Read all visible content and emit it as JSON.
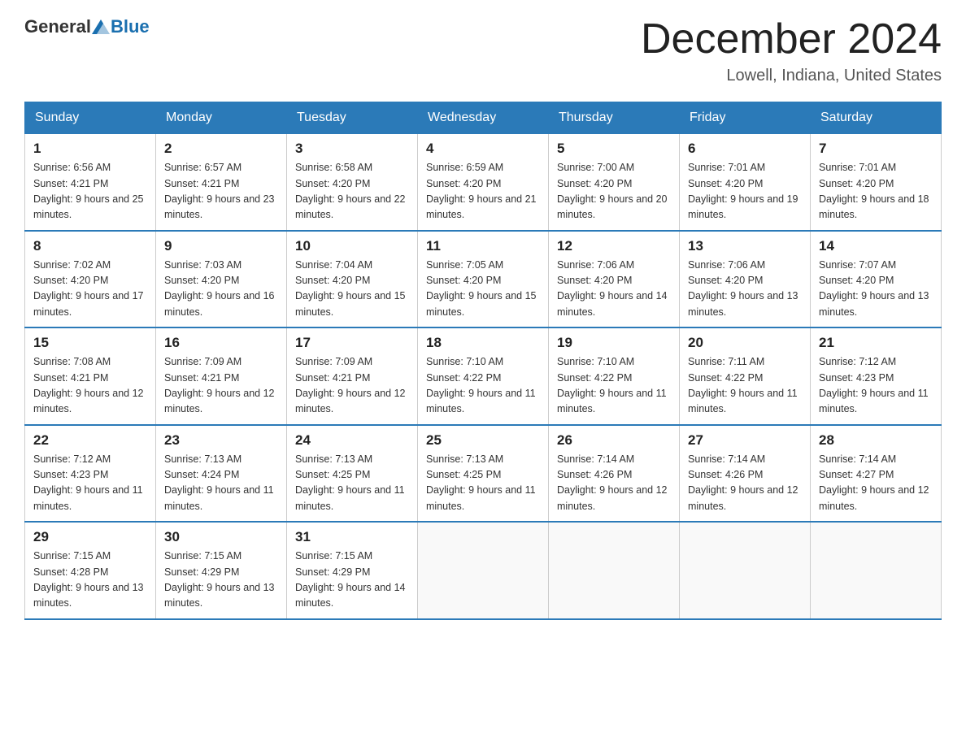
{
  "header": {
    "logo_general": "General",
    "logo_blue": "Blue",
    "title": "December 2024",
    "location": "Lowell, Indiana, United States"
  },
  "weekdays": [
    "Sunday",
    "Monday",
    "Tuesday",
    "Wednesday",
    "Thursday",
    "Friday",
    "Saturday"
  ],
  "weeks": [
    [
      {
        "day": "1",
        "sunrise": "6:56 AM",
        "sunset": "4:21 PM",
        "daylight": "9 hours and 25 minutes."
      },
      {
        "day": "2",
        "sunrise": "6:57 AM",
        "sunset": "4:21 PM",
        "daylight": "9 hours and 23 minutes."
      },
      {
        "day": "3",
        "sunrise": "6:58 AM",
        "sunset": "4:20 PM",
        "daylight": "9 hours and 22 minutes."
      },
      {
        "day": "4",
        "sunrise": "6:59 AM",
        "sunset": "4:20 PM",
        "daylight": "9 hours and 21 minutes."
      },
      {
        "day": "5",
        "sunrise": "7:00 AM",
        "sunset": "4:20 PM",
        "daylight": "9 hours and 20 minutes."
      },
      {
        "day": "6",
        "sunrise": "7:01 AM",
        "sunset": "4:20 PM",
        "daylight": "9 hours and 19 minutes."
      },
      {
        "day": "7",
        "sunrise": "7:01 AM",
        "sunset": "4:20 PM",
        "daylight": "9 hours and 18 minutes."
      }
    ],
    [
      {
        "day": "8",
        "sunrise": "7:02 AM",
        "sunset": "4:20 PM",
        "daylight": "9 hours and 17 minutes."
      },
      {
        "day": "9",
        "sunrise": "7:03 AM",
        "sunset": "4:20 PM",
        "daylight": "9 hours and 16 minutes."
      },
      {
        "day": "10",
        "sunrise": "7:04 AM",
        "sunset": "4:20 PM",
        "daylight": "9 hours and 15 minutes."
      },
      {
        "day": "11",
        "sunrise": "7:05 AM",
        "sunset": "4:20 PM",
        "daylight": "9 hours and 15 minutes."
      },
      {
        "day": "12",
        "sunrise": "7:06 AM",
        "sunset": "4:20 PM",
        "daylight": "9 hours and 14 minutes."
      },
      {
        "day": "13",
        "sunrise": "7:06 AM",
        "sunset": "4:20 PM",
        "daylight": "9 hours and 13 minutes."
      },
      {
        "day": "14",
        "sunrise": "7:07 AM",
        "sunset": "4:20 PM",
        "daylight": "9 hours and 13 minutes."
      }
    ],
    [
      {
        "day": "15",
        "sunrise": "7:08 AM",
        "sunset": "4:21 PM",
        "daylight": "9 hours and 12 minutes."
      },
      {
        "day": "16",
        "sunrise": "7:09 AM",
        "sunset": "4:21 PM",
        "daylight": "9 hours and 12 minutes."
      },
      {
        "day": "17",
        "sunrise": "7:09 AM",
        "sunset": "4:21 PM",
        "daylight": "9 hours and 12 minutes."
      },
      {
        "day": "18",
        "sunrise": "7:10 AM",
        "sunset": "4:22 PM",
        "daylight": "9 hours and 11 minutes."
      },
      {
        "day": "19",
        "sunrise": "7:10 AM",
        "sunset": "4:22 PM",
        "daylight": "9 hours and 11 minutes."
      },
      {
        "day": "20",
        "sunrise": "7:11 AM",
        "sunset": "4:22 PM",
        "daylight": "9 hours and 11 minutes."
      },
      {
        "day": "21",
        "sunrise": "7:12 AM",
        "sunset": "4:23 PM",
        "daylight": "9 hours and 11 minutes."
      }
    ],
    [
      {
        "day": "22",
        "sunrise": "7:12 AM",
        "sunset": "4:23 PM",
        "daylight": "9 hours and 11 minutes."
      },
      {
        "day": "23",
        "sunrise": "7:13 AM",
        "sunset": "4:24 PM",
        "daylight": "9 hours and 11 minutes."
      },
      {
        "day": "24",
        "sunrise": "7:13 AM",
        "sunset": "4:25 PM",
        "daylight": "9 hours and 11 minutes."
      },
      {
        "day": "25",
        "sunrise": "7:13 AM",
        "sunset": "4:25 PM",
        "daylight": "9 hours and 11 minutes."
      },
      {
        "day": "26",
        "sunrise": "7:14 AM",
        "sunset": "4:26 PM",
        "daylight": "9 hours and 12 minutes."
      },
      {
        "day": "27",
        "sunrise": "7:14 AM",
        "sunset": "4:26 PM",
        "daylight": "9 hours and 12 minutes."
      },
      {
        "day": "28",
        "sunrise": "7:14 AM",
        "sunset": "4:27 PM",
        "daylight": "9 hours and 12 minutes."
      }
    ],
    [
      {
        "day": "29",
        "sunrise": "7:15 AM",
        "sunset": "4:28 PM",
        "daylight": "9 hours and 13 minutes."
      },
      {
        "day": "30",
        "sunrise": "7:15 AM",
        "sunset": "4:29 PM",
        "daylight": "9 hours and 13 minutes."
      },
      {
        "day": "31",
        "sunrise": "7:15 AM",
        "sunset": "4:29 PM",
        "daylight": "9 hours and 14 minutes."
      },
      null,
      null,
      null,
      null
    ]
  ],
  "labels": {
    "sunrise": "Sunrise: ",
    "sunset": "Sunset: ",
    "daylight": "Daylight: "
  }
}
